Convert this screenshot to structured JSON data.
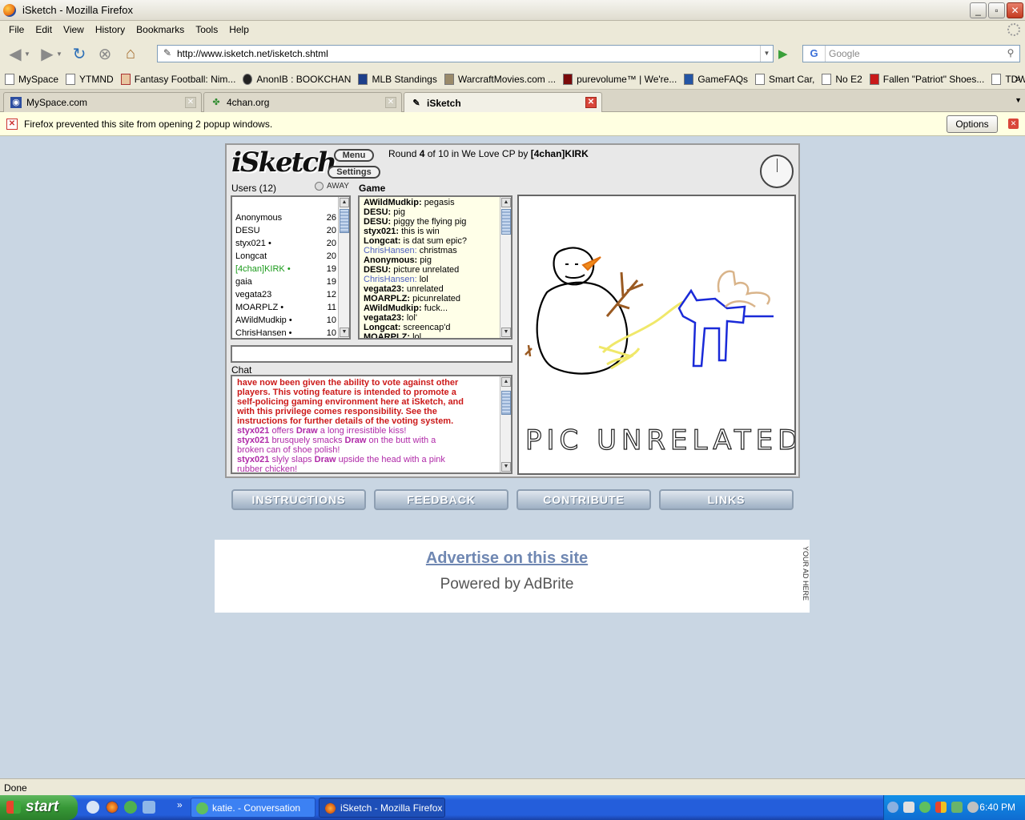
{
  "window": {
    "title": "iSketch - Mozilla Firefox",
    "buttons": {
      "minimize": "_",
      "maximize": "▫",
      "close": "✕"
    }
  },
  "menubar": [
    "File",
    "Edit",
    "View",
    "History",
    "Bookmarks",
    "Tools",
    "Help"
  ],
  "navbar": {
    "url": "http://www.isketch.net/isketch.shtml",
    "search_placeholder": "Google"
  },
  "bookmarks": [
    "MySpace",
    "YTMND",
    "Fantasy Football: Nim...",
    "AnonIB : BOOKCHAN",
    "MLB Standings",
    "WarcraftMovies.com ...",
    "purevolume™ | We're...",
    "GameFAQs",
    "Smart Car,",
    "No E2",
    "Fallen \"Patriot\" Shoes...",
    "TDWP"
  ],
  "bookmarks_more": "»",
  "tabs": [
    {
      "label": "MySpace.com",
      "active": false
    },
    {
      "label": "4chan.org",
      "active": false
    },
    {
      "label": "iSketch",
      "active": true
    }
  ],
  "notification": {
    "text": "Firefox prevented this site from opening 2 popup windows.",
    "options_label": "Options"
  },
  "game": {
    "logo": "iSketch",
    "menu_label": "Menu",
    "settings_label": "Settings",
    "round_prefix": "Round",
    "round": "4",
    "round_middle": "of 10 in We Love CP by",
    "host": "[4chan]KIRK",
    "users_title": "Users (12)",
    "away_label": "AWAY",
    "game_title": "Game",
    "chat_title": "Chat",
    "users": [
      {
        "name": "Anonymous",
        "score": "26"
      },
      {
        "name": "DESU",
        "score": "20"
      },
      {
        "name": "styx021 •",
        "score": "20"
      },
      {
        "name": "Longcat",
        "score": "20"
      },
      {
        "name": "[4chan]KIRK •",
        "score": "19"
      },
      {
        "name": "gaia",
        "score": "19"
      },
      {
        "name": "vegata23",
        "score": "12"
      },
      {
        "name": "MOARPLZ •",
        "score": "11"
      },
      {
        "name": "AWildMudkip •",
        "score": "10"
      },
      {
        "name": "ChrisHansen •",
        "score": "10"
      }
    ],
    "game_log": [
      {
        "name": "AWildMudkip:",
        "text": "pegasis"
      },
      {
        "name": "DESU:",
        "text": "pig"
      },
      {
        "name": "DESU:",
        "text": "piggy the flying pig"
      },
      {
        "name": "styx021:",
        "text": "this is win"
      },
      {
        "name": "Longcat:",
        "text": "is dat sum epic?"
      },
      {
        "name": "ChrisHansen:",
        "text": "christmas"
      },
      {
        "name": "Anonymous:",
        "text": "pig"
      },
      {
        "name": "DESU:",
        "text": "picture unrelated"
      },
      {
        "name": "ChrisHansen:",
        "text": "lol"
      },
      {
        "name": "vegata23:",
        "text": "unrelated"
      },
      {
        "name": "MOARPLZ:",
        "text": "picunrelated"
      },
      {
        "name": "AWildMudkip:",
        "text": "fuck..."
      },
      {
        "name": "vegata23:",
        "text": "lol'"
      },
      {
        "name": "Longcat:",
        "text": "screencap'd"
      },
      {
        "name": "MOARPLZ:",
        "text": "lol"
      }
    ],
    "chat_system": [
      "have now been given the ability to vote against other",
      "players. This voting feature is intended to promote a",
      "self-policing gaming environment here at iSketch, and",
      "with this privilege comes responsibility. See the",
      "instructions for further details of the voting system."
    ],
    "chat_actions": [
      {
        "actor": "styx021",
        "pre": "offers",
        "target": "Draw",
        "post": "a long irresistible kiss!"
      },
      {
        "actor": "styx021",
        "pre": "brusquely smacks",
        "target": "Draw",
        "post": "on the butt with a"
      },
      {
        "actor": "",
        "pre": "broken can of shoe polish!",
        "target": "",
        "post": ""
      },
      {
        "actor": "styx021",
        "pre": "slyly slaps",
        "target": "Draw",
        "post": "upside the head with a pink"
      },
      {
        "actor": "",
        "pre": "rubber chicken!",
        "target": "",
        "post": ""
      }
    ],
    "drawing_caption": "PIC UNRELATED",
    "bottom_nav": [
      "INSTRUCTIONS",
      "FEEDBACK",
      "CONTRIBUTE",
      "LINKS"
    ]
  },
  "ad": {
    "link": "Advertise on this site",
    "powered_by": "Powered by AdBrite",
    "vertical": "YOUR AD HERE"
  },
  "statusbar": {
    "text": "Done"
  },
  "taskbar": {
    "start_label": "start",
    "quicklaunch_more": "»",
    "tasks": [
      {
        "label": "katie. - Conversation",
        "active": false
      },
      {
        "label": "iSketch - Mozilla Firefox",
        "active": true
      }
    ],
    "clock": "6:40 PM"
  },
  "colors": {
    "page_bg": "#c9d6e3",
    "user_highlight": "#1a9a1a",
    "system_chat": "#cc1a1a",
    "action_chat": "#b02aa8",
    "guesser_blue": "#4c5fc0",
    "ad_link": "#6f87b2",
    "taskbar_blue": "#245edb",
    "start_green": "#379837"
  }
}
